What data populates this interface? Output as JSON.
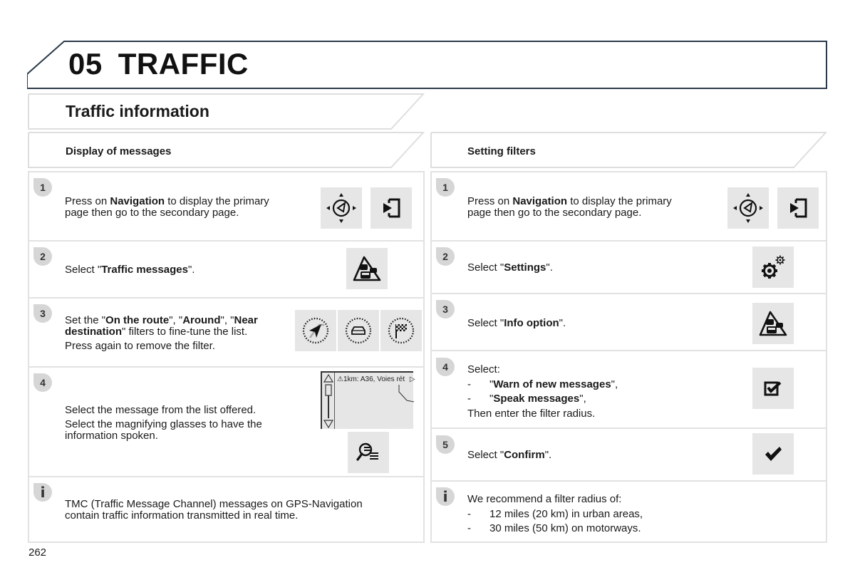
{
  "chapter": {
    "number": "05",
    "title": "TRAFFIC"
  },
  "section": {
    "title": "Traffic information"
  },
  "left_column": {
    "header": "Display of messages",
    "steps": [
      {
        "badge": "1",
        "text_parts": {
          "a": "Press on ",
          "b": "Navigation",
          "c": " to display the primary",
          "d": "page then go to the secondary page."
        },
        "icons": [
          "navigation-icon",
          "secondary-page-icon"
        ]
      },
      {
        "badge": "2",
        "text_parts": {
          "a": "Select \"",
          "b": "Traffic messages",
          "c": "\"."
        },
        "icons": [
          "traffic-messages-icon"
        ]
      },
      {
        "badge": "3",
        "text_parts": {
          "a": "Set the \"",
          "b": "On the route",
          "c": "\", \"",
          "d": "Around",
          "e": "\", \"",
          "f": "Near",
          "g": "destination",
          "h": "\" filters to fine-tune the list.",
          "i": "Press again to remove the filter."
        },
        "icons": [
          "on-the-route-filter-icon",
          "around-filter-icon",
          "near-destination-filter-icon"
        ]
      },
      {
        "badge": "4",
        "text_parts": {
          "a": "Select the message from the list offered.",
          "b": "Select the magnifying glasses to have the",
          "c": "information spoken."
        },
        "screen_message": "1km: A36, Voies rét",
        "icons": [
          "magnifying-glass-list-icon"
        ]
      }
    ],
    "info": {
      "badge": "i",
      "line1": "TMC (Traffic Message Channel) messages on GPS-Navigation",
      "line2": "contain traffic information transmitted in real time."
    }
  },
  "right_column": {
    "header": "Setting filters",
    "steps": [
      {
        "badge": "1",
        "text_parts": {
          "a": "Press on ",
          "b": "Navigation",
          "c": " to display the primary",
          "d": "page then go to the secondary page."
        },
        "icons": [
          "navigation-icon",
          "secondary-page-icon"
        ]
      },
      {
        "badge": "2",
        "text_parts": {
          "a": "Select \"",
          "b": "Settings",
          "c": "\"."
        },
        "icons": [
          "settings-icon"
        ]
      },
      {
        "badge": "3",
        "text_parts": {
          "a": "Select \"",
          "b": "Info option",
          "c": "\"."
        },
        "icons": [
          "traffic-messages-icon"
        ]
      },
      {
        "badge": "4",
        "text_parts": {
          "a": "Select:",
          "dash": "-",
          "b1": "\"",
          "b2": "Warn of new messages",
          "b3": "\",",
          "c1": "\"",
          "c2": "Speak messages",
          "c3": "\",",
          "d": "Then enter the filter radius."
        },
        "icons": [
          "checkbox-checked-icon"
        ]
      },
      {
        "badge": "5",
        "text_parts": {
          "a": "Select \"",
          "b": "Confirm",
          "c": "\"."
        },
        "icons": [
          "confirm-check-icon"
        ]
      }
    ],
    "info": {
      "badge": "i",
      "line1": "We recommend a filter radius of:",
      "dash": "-",
      "item1": "12 miles (20 km) in urban areas,",
      "item2": "30 miles (50 km) on motorways."
    }
  },
  "page_number": "262",
  "colors": {
    "border": "#e2e2e2",
    "badge": "#d6d6d6",
    "icon_bg": "#e6e6e6",
    "header_line": "#2b3a4a"
  }
}
